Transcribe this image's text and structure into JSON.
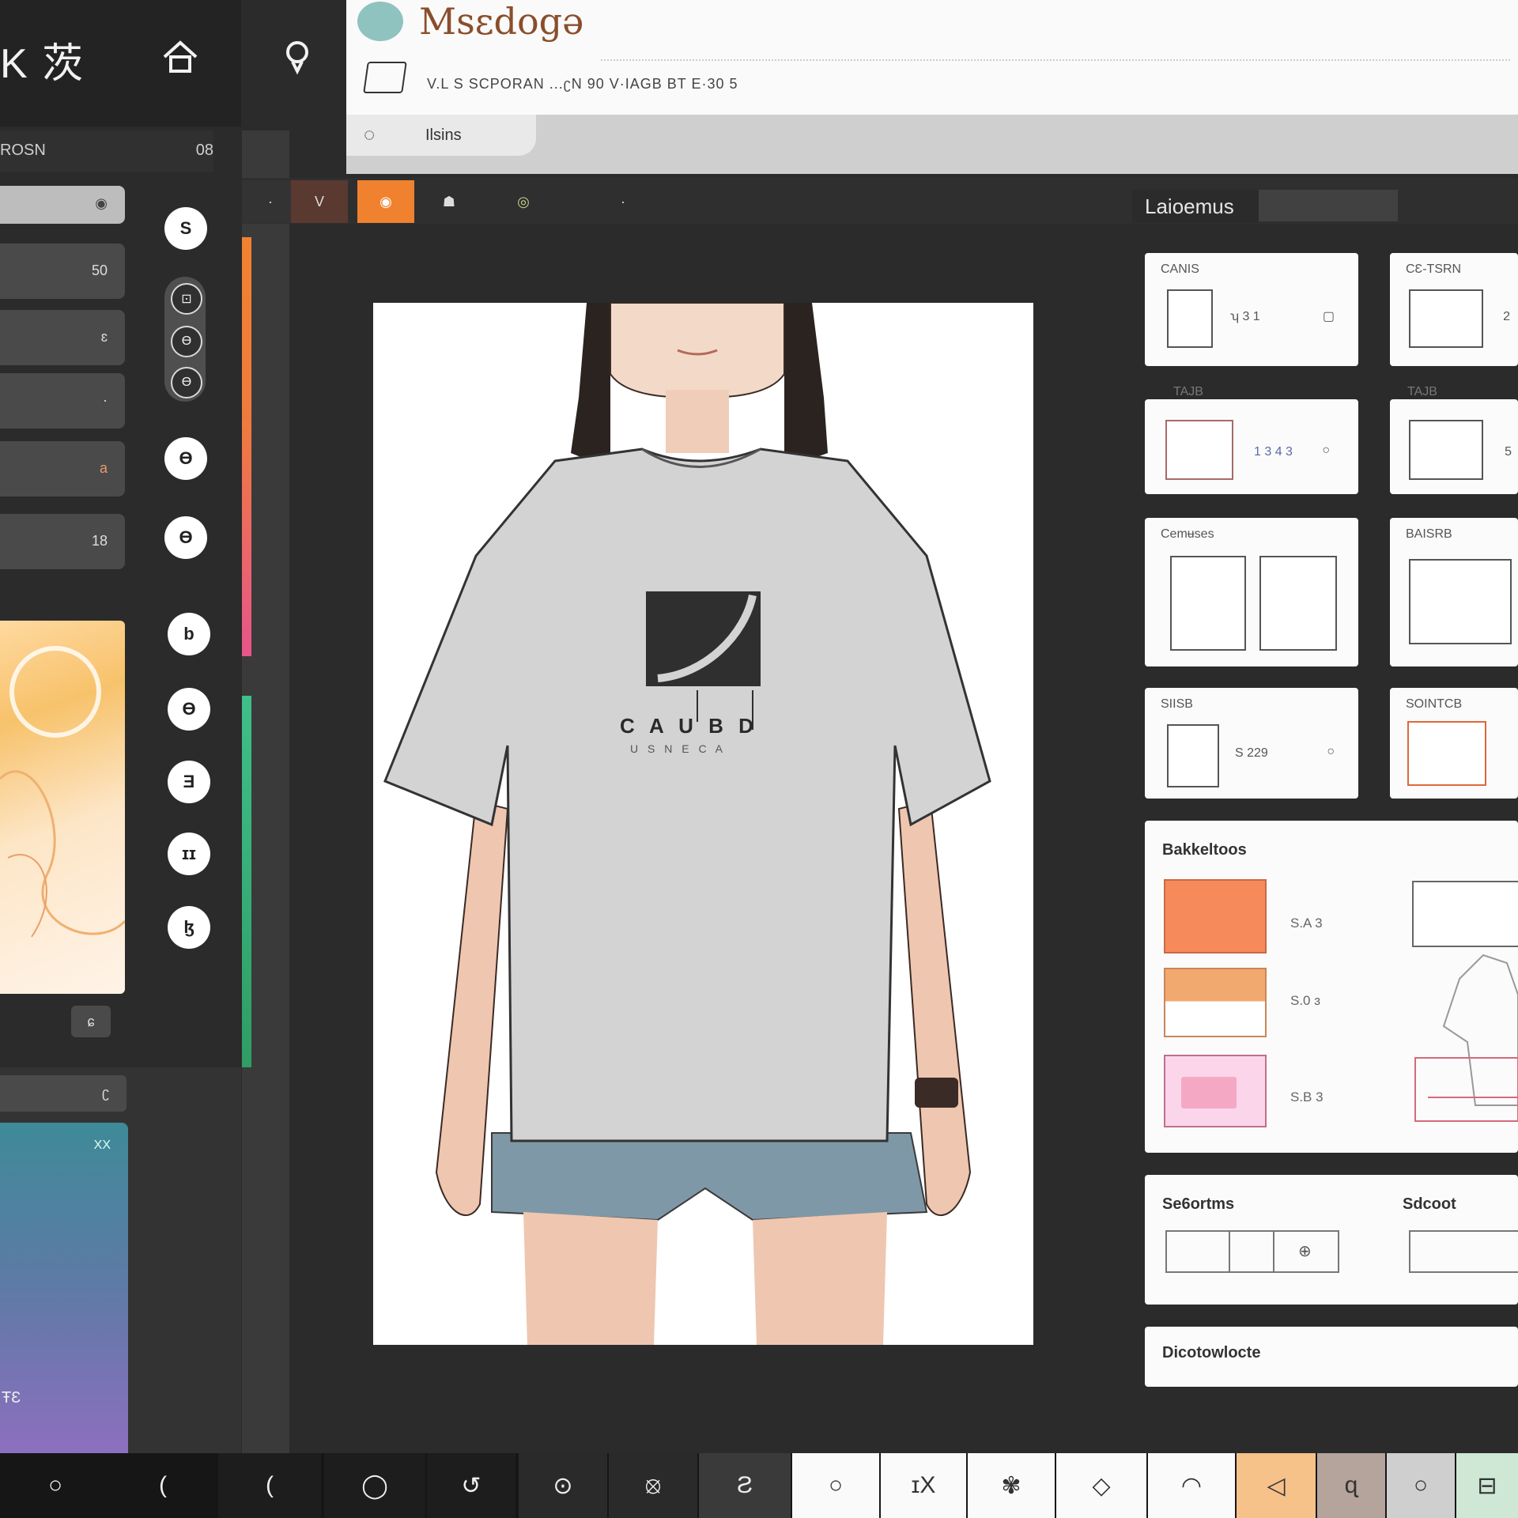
{
  "app": {
    "title": "Msɛdogə",
    "logo_icon": "brand-icon"
  },
  "header": {
    "subtitle": "V.L  S SCPORAN  ...ʗN  90  V·IAGB BT  E·30 5",
    "tab_label": "Ilsins"
  },
  "left": {
    "title": "K 茨",
    "sub_label": "ROSN",
    "sub_right": "08",
    "layers": [
      {
        "val": ""
      },
      {
        "val": "50"
      },
      {
        "val": "ɛ"
      },
      {
        "val": "·"
      },
      {
        "val": "a"
      },
      {
        "val": "18"
      }
    ],
    "circle_buttons": [
      "S",
      "Ɵ",
      "Ɵ",
      "b",
      "Ɵ",
      "Ǝ",
      "ɪɪ",
      "ɮ"
    ],
    "pill_dots": [
      "⊡",
      "Ɵ",
      "Ɵ"
    ],
    "small_btn": "ɕ",
    "lower_icon": "ʗ",
    "grad_top": "XX",
    "grad_bottom": "ŦƐ"
  },
  "toolbar": {
    "buttons": [
      "·",
      "V",
      "◉",
      "☗",
      "◎",
      "·"
    ],
    "panel_label": "Laioemus"
  },
  "right_panel": {
    "cards": [
      {
        "title": "CANIS",
        "meta": "ʮ 3 1"
      },
      {
        "title": "CƐ-TSRN",
        "meta": "2"
      },
      {
        "title": "TAJB",
        "meta": "1 3 4 3"
      },
      {
        "title": "TAJB",
        "meta": "5"
      },
      {
        "title": "Cemʉses",
        "meta": ""
      },
      {
        "title": "BAISRB",
        "meta": ""
      },
      {
        "title": "SIISB",
        "meta": "S 229"
      },
      {
        "title": "SOINTCB",
        "meta": ""
      }
    ],
    "swatches_title": "Bakkeltoos",
    "swatches": [
      {
        "label": "S.A 3",
        "color": "#f68a5a"
      },
      {
        "label": "S.0 ɜ",
        "color": "#f2a96f"
      },
      {
        "label": "S.B 3",
        "color": "#f9c3dd"
      }
    ],
    "section2_title": "Se6ortms",
    "section2_right": "Sdcoot",
    "section3_title": "Dicotowlocte"
  },
  "shirt": {
    "logo_text": "C A U  B D",
    "logo_sub": "U S N E C A"
  },
  "bottom_bar": {
    "items": [
      "○",
      "(",
      "(",
      "◯",
      "↺",
      "⊙",
      "⦻",
      "Ƨ",
      "○",
      "ɪX",
      "✾",
      "◇",
      "◠",
      "◁",
      "ɋ",
      "○",
      "⊟"
    ]
  },
  "colors": {
    "accent": "#f0822f",
    "panel_dark": "#2b2b2c",
    "card_bg": "#fbfbfb"
  }
}
